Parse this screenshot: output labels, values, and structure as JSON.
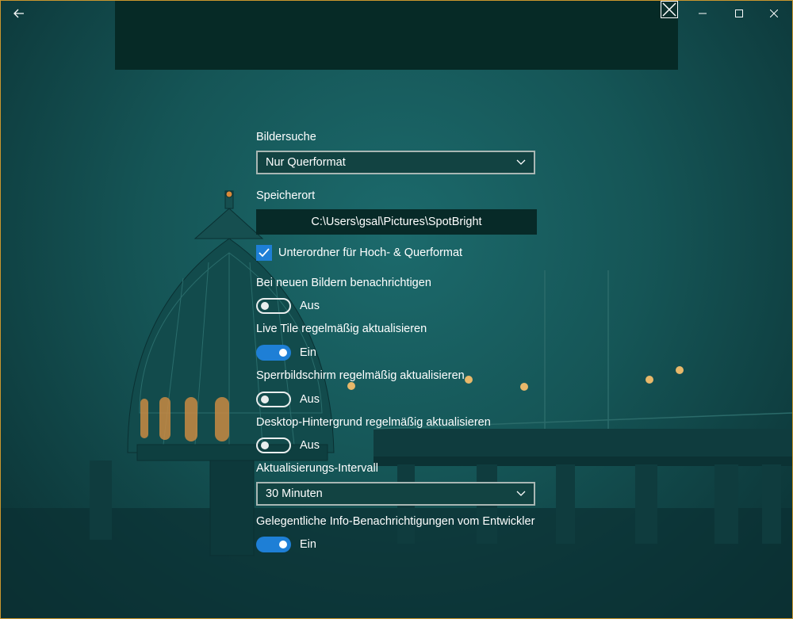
{
  "titlebar": {
    "back_icon": "back-arrow-icon",
    "minimize_icon": "minimize-icon",
    "maximize_icon": "maximize-icon",
    "close_icon": "close-icon"
  },
  "banner": {
    "close_icon": "close-icon"
  },
  "settings": {
    "image_search": {
      "label": "Bildersuche",
      "value": "Nur Querformat"
    },
    "storage": {
      "label": "Speicherort",
      "path": "C:\\Users\\gsal\\Pictures\\SpotBright"
    },
    "subfolders": {
      "label": "Unterordner für Hoch- & Querformat",
      "checked": true
    },
    "notify_new": {
      "label": "Bei neuen Bildern benachrichtigen",
      "state": "Aus",
      "on": false
    },
    "live_tile": {
      "label": "Live Tile regelmäßig aktualisieren",
      "state": "Ein",
      "on": true
    },
    "lockscreen": {
      "label": "Sperrbildschirm regelmäßig aktualisieren",
      "state": "Aus",
      "on": false
    },
    "desktop": {
      "label": "Desktop-Hintergrund regelmäßig aktualisieren",
      "state": "Aus",
      "on": false
    },
    "interval": {
      "label": "Aktualisierungs-Intervall",
      "value": "30 Minuten"
    },
    "dev_info": {
      "label": "Gelegentliche Info-Benachrichtigungen vom Entwickler",
      "state": "Ein",
      "on": true
    }
  },
  "colors": {
    "accent": "#1e7fd6",
    "window_border": "#c9962e",
    "background": "#155556"
  }
}
